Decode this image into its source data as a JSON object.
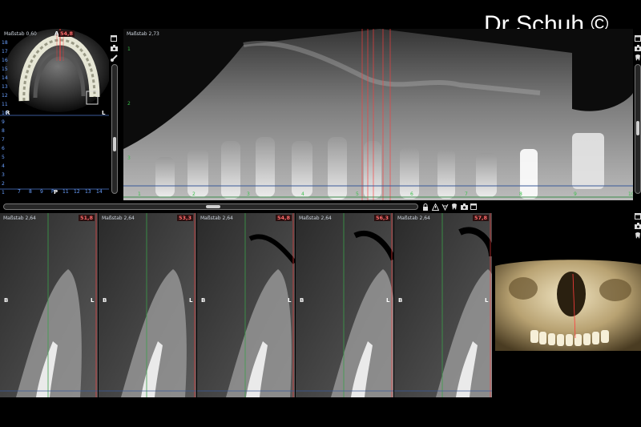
{
  "watermark": "Dr Schuh ©",
  "axial": {
    "scale_label": "Maßstab 0,60",
    "marker_value": "54,8",
    "orient_top": "A",
    "orient_left": "R",
    "orient_right": "L",
    "orient_bottom": "P",
    "bottom_ticks": [
      "7",
      "8",
      "9",
      "P",
      "11",
      "12",
      "13",
      "14"
    ],
    "left_ticks": [
      "18",
      "17",
      "16",
      "15",
      "14",
      "13",
      "12",
      "11",
      "10",
      "9",
      "8",
      "7",
      "6",
      "5",
      "4",
      "3",
      "2",
      "1"
    ]
  },
  "panoramic": {
    "scale_label": "Maßstab 2,73",
    "left_ticks": [
      "1",
      "2",
      "3"
    ],
    "bottom_ticks": [
      "1",
      "2",
      "3",
      "4",
      "5",
      "6",
      "7",
      "8",
      "9",
      "10"
    ]
  },
  "cross_sections": [
    {
      "scale_label": "Maßstab 2,64",
      "position": "51,8",
      "left_side": "B",
      "right_side": "L"
    },
    {
      "scale_label": "Maßstab 2,64",
      "position": "53,3",
      "left_side": "B",
      "right_side": "L"
    },
    {
      "scale_label": "Maßstab 2,64",
      "position": "54,8",
      "left_side": "B",
      "right_side": "L"
    },
    {
      "scale_label": "Maßstab 2,64",
      "position": "56,3",
      "left_side": "B",
      "right_side": "L"
    },
    {
      "scale_label": "Maßstab 2,64",
      "position": "57,8",
      "left_side": "B",
      "right_side": "L"
    }
  ],
  "icons": {
    "toolbar": [
      "lock-icon",
      "warning-icon",
      "tooth-cut-icon",
      "tooth-icon",
      "camera-icon",
      "window-icon"
    ],
    "side_top": [
      "window-icon",
      "camera-icon",
      "brush-icon"
    ],
    "side_right": [
      "window-icon",
      "camera-icon",
      "tooth-icon"
    ]
  }
}
